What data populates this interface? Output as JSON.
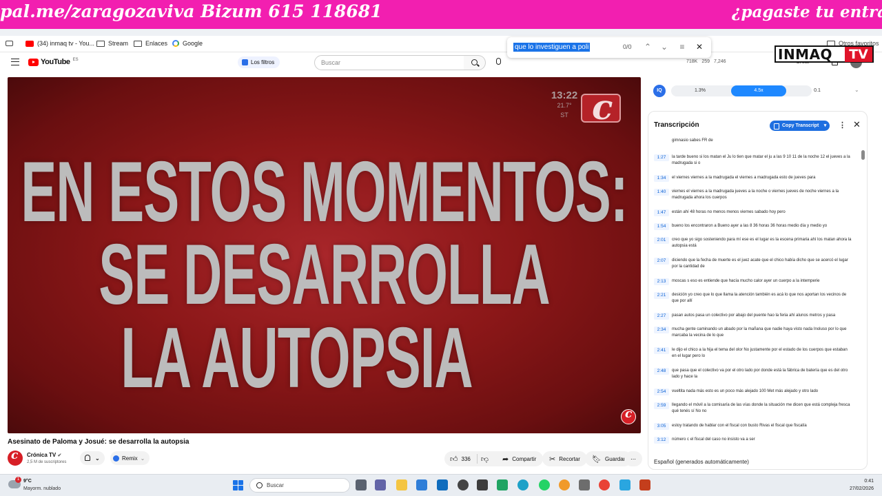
{
  "banner": {
    "left_text": "pal.me/zaragozaviva Bizum 615 118681",
    "right_text": "¿pagaste tu entrada"
  },
  "bookmarks": [
    {
      "label": "(34) inmaq tv - You...",
      "icon": "youtube-icon"
    },
    {
      "label": "Stream",
      "icon": "folder-icon"
    },
    {
      "label": "Enlaces",
      "icon": "folder-icon"
    },
    {
      "label": "Google",
      "icon": "google-icon"
    }
  ],
  "bookmarks_other": "Otros favoritos",
  "findbar": {
    "query": "que lo investiguen a poli",
    "count": "0/0"
  },
  "overlay_logo": {
    "word": "INMAQ",
    "tv": "TV"
  },
  "youtube": {
    "logo": "YouTube",
    "region": "ES",
    "filters_label": "Los filtros",
    "search_placeholder": "Buscar",
    "stats": [
      "718K",
      "259",
      "7,246"
    ],
    "create_label": "Crear"
  },
  "video": {
    "line1": "EN ESTOS MOMENTOS:",
    "line2": "SE DESARROLLA",
    "line3": "LA AUTOPSIA",
    "clock_time": "13:22",
    "clock_sub1": "21.7°",
    "clock_sub2": "ST"
  },
  "below_video": {
    "title": "Asesinato de Paloma y Josué: se desarrolla la autopsia",
    "channel": "Crónica TV",
    "subscribers": "2,5 M de suscriptores",
    "remix": "Remix",
    "likes": "336",
    "share": "Compartir",
    "clip": "Recortar",
    "save": "Guardar"
  },
  "extension": {
    "badge": "IQ",
    "segments": [
      "1.3%",
      "4.5x",
      "0.1"
    ]
  },
  "transcript": {
    "title": "Transcripción",
    "copy_label": "Copy Transcript",
    "language": "Español (generados automáticamente)",
    "rows": [
      {
        "t": "",
        "text": "gimnasio sabes FR de"
      },
      {
        "t": "1:27",
        "text": "la tarde bueno si los matan el Ju lo tien que matar el ju a las 9 10 11 de la noche 12 el jueves a la madrugada si o"
      },
      {
        "t": "1:34",
        "text": "el viernes viernes a la madrugada el viernes a madrugada esto de jueves para"
      },
      {
        "t": "1:40",
        "text": "viernes el viernes a la madrugada jueves a la noche o viernes jueves de noche viernes a la madrugada ahora los cuerpos"
      },
      {
        "t": "1:47",
        "text": "están ahí 48 horas no menos menos viernes sabado hoy pero"
      },
      {
        "t": "1:54",
        "text": "bueno los encontraron a Bueno ayer a las 8 36 horas 36 horas medio día y medio yo"
      },
      {
        "t": "2:01",
        "text": "creo que yo sigo sosteniendo para mí ese es el lugar es la escena primaria ahí los matan ahora la autopsia está"
      },
      {
        "t": "2:07",
        "text": "diciendo que la fecha de muerte es el juez acate que el chico había dicho que se acercó el lugar por la cantidad de"
      },
      {
        "t": "2:13",
        "text": "moscas s eso es entiende que hacía mucho calor ayer un cuerpo a la intemperie"
      },
      {
        "t": "2:21",
        "text": "desición yo creo que lo que llama la atención también es acá lo que nos aportan los vecinos de que por allí"
      },
      {
        "t": "2:27",
        "text": "pasan autos pasa un colectivo por abajo del puente hao la feria ahí alunos metros y pasa"
      },
      {
        "t": "2:34",
        "text": "mucha gente caminando un abado por la mañana que nadie haya visto nada Inoluso por lo que marcaba la vecina de lo que"
      },
      {
        "t": "2:41",
        "text": "le dijo el chico a la hija el tema del olor No justamente por el estado de los cuerpos que estaban en el lugar pero lo"
      },
      {
        "t": "2:48",
        "text": "que pasa que el colectivo va por el otro lado por donde está la fábrica de batería que es del otro lado y hace la"
      },
      {
        "t": "2:54",
        "text": "vueltita nada más esto es un poco más alejado 100 Met más alejado y otro lado"
      },
      {
        "t": "2:59",
        "text": "llegando el móvil a la comisaría de las vías donde la situación me dicen que está compleja fresca qué tenés sí No no"
      },
      {
        "t": "3:05",
        "text": "estoy tratando de hablar con el fiscal con busto Rivas el fiscal que fiscalía"
      },
      {
        "t": "3:12",
        "text": "número c el fiscal del caso no insisto va a ser"
      }
    ]
  },
  "taskbar": {
    "temp": "9°C",
    "weather": "Mayorm. nublado",
    "search": "Buscar",
    "time": "0:41",
    "date": "27/02/2026"
  },
  "colors": {
    "banner": "#f21fb0",
    "video_bg": "#8b1718",
    "accent_blue": "#1e6fe0",
    "yt_red": "#ff0000"
  }
}
